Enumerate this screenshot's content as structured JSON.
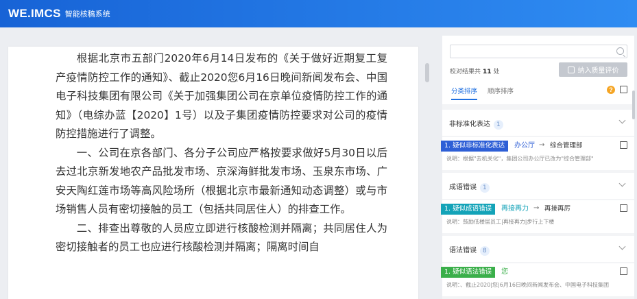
{
  "app": {
    "logo": "WE.IMCS",
    "subtitle": "智能核稿系统"
  },
  "document": {
    "paragraphs": [
      "根据北京市五部门2020年6月14日发布的《关于做好近期复工复产疫情防控工作的通知》、截止2020您6月16日晚间新闻发布会、中国电子科技集团有限公司《关于加强集团公司在京单位疫情防控工作的通知》（电综办蓝【2020】1号）以及子集团疫情防控要求对公司的疫情防控措施进行了调整。",
      "一、公司在京各部门、各分子公司应严格按要求做好5月30日以后去过北京新发地农产品批发市场、京深海鲜批发市场、玉泉东市场、广安天陶红莲市场等高风险场所（根据北京市最新通知动态调整）或与市场销售人员有密切接触的员工（包括共同居住人）的排查工作。",
      "二、排查出尊敬的人员应立即进行核酸检测并隔离；共同居住人为密切接触者的员工也应进行核酸检测并隔离；隔离时间自"
    ]
  },
  "panel": {
    "search": {
      "placeholder": ""
    },
    "result_label": "校对结果共",
    "result_count": "11",
    "result_unit": "处",
    "quality_button": "纳入质量评价",
    "tabs": [
      "分类排序",
      "顺序排序"
    ],
    "help": "?",
    "groups": [
      {
        "title": "非标准化表达",
        "count": "1",
        "item": {
          "tag": "1. 疑似非标准化表达",
          "tag_color": "#2e5fd6",
          "original": "办公厅",
          "original_color": "#2e5fd6",
          "arrow": "→",
          "suggestion": "综合管理部",
          "note": "说明：根据\"去机关化\"，集团公司办公厅已改为\"综合管理部\""
        }
      },
      {
        "title": "成语错误",
        "count": "1",
        "item": {
          "tag": "1. 疑似成语错误",
          "tag_color": "#13a3b8",
          "original": "再接再力",
          "original_color": "#13a3b8",
          "arrow": "→",
          "suggestion": "再接再厉",
          "note": "说明：鼓励低楼层员工|再接再力|步行上下楼"
        }
      },
      {
        "title": "语法错误",
        "count": "8",
        "item": {
          "tag": "1. 疑似语法错误",
          "tag_color": "#3aaf4a",
          "original": "您",
          "original_color": "#3aaf4a",
          "arrow": "",
          "suggestion": "",
          "note": "说明：、截止2020|您|6月16日晚间新闻发布会、中国电子科技集团"
        }
      }
    ]
  }
}
